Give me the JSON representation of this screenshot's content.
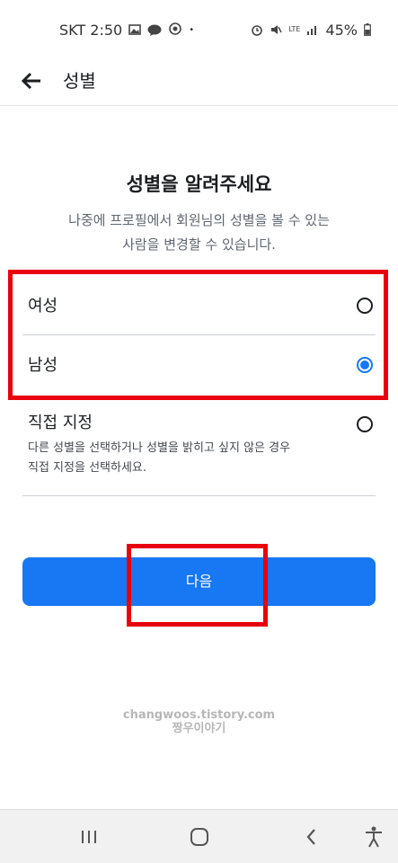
{
  "status_bar": {
    "carrier_time": "SKT 2:50",
    "dot": "•",
    "network": "LTE",
    "battery": "45%",
    "icons": [
      "image-icon",
      "chat-bubble-icon",
      "location-pin-icon",
      "alarm-icon",
      "mute-icon",
      "lte-icon",
      "signal-icon",
      "battery-icon"
    ]
  },
  "app_bar": {
    "title": "성별"
  },
  "main": {
    "heading": "성별을 알려주세요",
    "description_line1": "나중에 프로필에서 회원님의 성별을 볼 수 있는",
    "description_line2": "사람을 변경할 수 있습니다.",
    "options": [
      {
        "label": "여성",
        "selected": false
      },
      {
        "label": "남성",
        "selected": true
      },
      {
        "label": "직접 지정",
        "selected": false,
        "description_line1": "다른 성별을 선택하거나 성별을 밝히고 싶지 않은 경우",
        "description_line2": "직접 지정을 선택하세요."
      }
    ],
    "next_button": "다음"
  },
  "watermark": {
    "line1": "changwoos.tistory.com",
    "line2": "짱우이야기"
  },
  "colors": {
    "accent": "#1877f2",
    "highlight": "#e8000b"
  }
}
